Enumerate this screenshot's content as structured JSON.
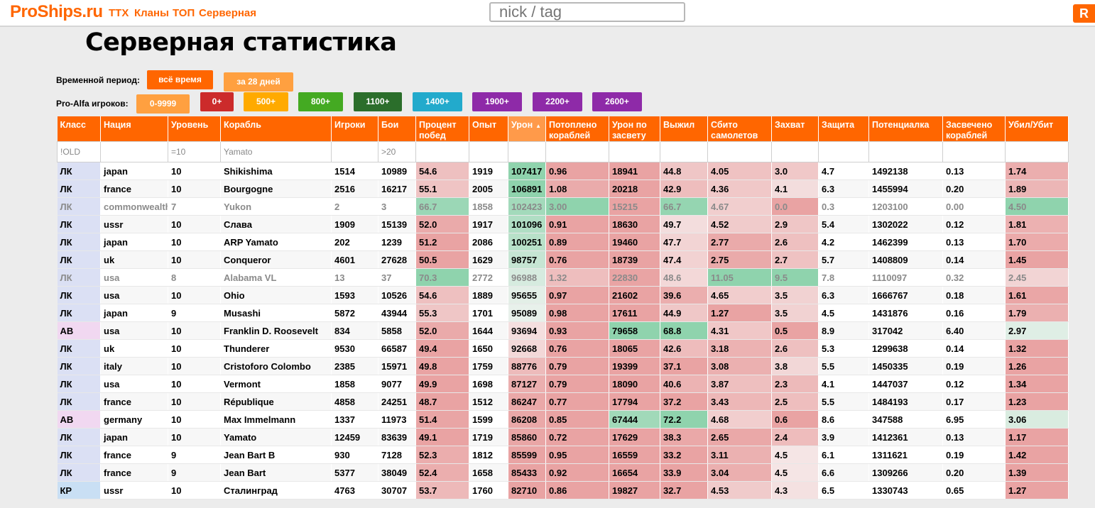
{
  "header": {
    "logo": "ProShips.ru",
    "nav": [
      "ТТХ",
      "Кланы",
      "ТОП",
      "Серверная"
    ],
    "search_placeholder": "nick / tag",
    "corner_button": "R"
  },
  "page_title": "Серверная статистика",
  "filters": {
    "period_label": "Временной период:",
    "period_buttons": [
      "всё время",
      "за 28 дней"
    ],
    "pro_label": "Pro-Alfa игроков:",
    "pro_buttons": [
      "0-9999",
      "0+",
      "500+",
      "800+",
      "1100+",
      "1400+",
      "1900+",
      "2200+",
      "2600+"
    ]
  },
  "colors": {
    "accent": "#ff6600",
    "good": "#8fd3ad",
    "bad": "#e9a3a3",
    "class_ЛК": "#dbe0f4",
    "class_АВ": "#f1d8f1",
    "class_КР": "#c9dff4"
  },
  "table": {
    "columns": [
      "Класс",
      "Нация",
      "Уровень",
      "Корабль",
      "Игроки",
      "Бои",
      "Процент побед",
      "Опыт",
      "Урон",
      "Потоплено кораблей",
      "Урон по засвету",
      "Выжил",
      "Сбито самолетов",
      "Захват",
      "Защита",
      "Потенциалка",
      "Засвечено кораблей",
      "Убил/Убит"
    ],
    "sorted_column": "Урон",
    "filters": [
      "!OLD",
      "",
      "=10",
      "Yamato",
      "",
      ">20",
      "",
      "",
      "",
      "",
      "",
      "",
      "",
      "",
      "",
      "",
      "",
      ""
    ],
    "rows": [
      {
        "dim": false,
        "cells": [
          "ЛК",
          "japan",
          "10",
          "Shikishima",
          "1514",
          "10989",
          "54.6",
          "1919",
          "107417",
          "0.96",
          "18941",
          "44.8",
          "4.05",
          "3.0",
          "4.7",
          "1492138",
          "0.13",
          "1.74"
        ]
      },
      {
        "dim": false,
        "cells": [
          "ЛК",
          "france",
          "10",
          "Bourgogne",
          "2516",
          "16217",
          "55.1",
          "2005",
          "106891",
          "1.08",
          "20218",
          "42.9",
          "4.36",
          "4.1",
          "6.3",
          "1455994",
          "0.20",
          "1.89"
        ]
      },
      {
        "dim": true,
        "cells": [
          "ЛК",
          "commonwealth",
          "7",
          "Yukon",
          "2",
          "3",
          "66.7",
          "1858",
          "102423",
          "3.00",
          "15215",
          "66.7",
          "4.67",
          "0.0",
          "0.3",
          "1203100",
          "0.00",
          "4.50"
        ]
      },
      {
        "dim": false,
        "cells": [
          "ЛК",
          "ussr",
          "10",
          "Слава",
          "1909",
          "15139",
          "52.0",
          "1917",
          "101096",
          "0.91",
          "18630",
          "49.7",
          "4.52",
          "2.9",
          "5.4",
          "1302022",
          "0.12",
          "1.81"
        ]
      },
      {
        "dim": false,
        "cells": [
          "ЛК",
          "japan",
          "10",
          "ARP Yamato",
          "202",
          "1239",
          "51.2",
          "2086",
          "100251",
          "0.89",
          "19460",
          "47.7",
          "2.77",
          "2.6",
          "4.2",
          "1462399",
          "0.13",
          "1.70"
        ]
      },
      {
        "dim": false,
        "cells": [
          "ЛК",
          "uk",
          "10",
          "Conqueror",
          "4601",
          "27628",
          "50.5",
          "1629",
          "98757",
          "0.76",
          "18739",
          "47.4",
          "2.75",
          "2.7",
          "5.7",
          "1408809",
          "0.14",
          "1.45"
        ]
      },
      {
        "dim": true,
        "cells": [
          "ЛК",
          "usa",
          "8",
          "Alabama VL",
          "13",
          "37",
          "70.3",
          "2772",
          "96988",
          "1.32",
          "22830",
          "48.6",
          "11.05",
          "9.5",
          "7.8",
          "1110097",
          "0.32",
          "2.45"
        ]
      },
      {
        "dim": false,
        "cells": [
          "ЛК",
          "usa",
          "10",
          "Ohio",
          "1593",
          "10526",
          "54.6",
          "1889",
          "95655",
          "0.97",
          "21602",
          "39.6",
          "4.65",
          "3.5",
          "6.3",
          "1666767",
          "0.18",
          "1.61"
        ]
      },
      {
        "dim": false,
        "cells": [
          "ЛК",
          "japan",
          "9",
          "Musashi",
          "5872",
          "43944",
          "55.3",
          "1701",
          "95089",
          "0.98",
          "17611",
          "44.9",
          "1.27",
          "3.5",
          "4.5",
          "1431876",
          "0.16",
          "1.79"
        ]
      },
      {
        "dim": false,
        "cells": [
          "АВ",
          "usa",
          "10",
          "Franklin D. Roosevelt",
          "834",
          "5858",
          "52.0",
          "1644",
          "93694",
          "0.93",
          "79658",
          "68.8",
          "4.31",
          "0.5",
          "8.9",
          "317042",
          "6.40",
          "2.97"
        ]
      },
      {
        "dim": false,
        "cells": [
          "ЛК",
          "uk",
          "10",
          "Thunderer",
          "9530",
          "66587",
          "49.4",
          "1650",
          "92668",
          "0.76",
          "18065",
          "42.6",
          "3.18",
          "2.6",
          "5.3",
          "1299638",
          "0.14",
          "1.32"
        ]
      },
      {
        "dim": false,
        "cells": [
          "ЛК",
          "italy",
          "10",
          "Cristoforo Colombo",
          "2385",
          "15971",
          "49.8",
          "1759",
          "88776",
          "0.79",
          "19399",
          "37.1",
          "3.08",
          "3.8",
          "5.5",
          "1450335",
          "0.19",
          "1.26"
        ]
      },
      {
        "dim": false,
        "cells": [
          "ЛК",
          "usa",
          "10",
          "Vermont",
          "1858",
          "9077",
          "49.9",
          "1698",
          "87127",
          "0.79",
          "18090",
          "40.6",
          "3.87",
          "2.3",
          "4.1",
          "1447037",
          "0.12",
          "1.34"
        ]
      },
      {
        "dim": false,
        "cells": [
          "ЛК",
          "france",
          "10",
          "République",
          "4858",
          "24251",
          "48.7",
          "1512",
          "86247",
          "0.77",
          "17794",
          "37.2",
          "3.43",
          "2.5",
          "5.5",
          "1484193",
          "0.17",
          "1.23"
        ]
      },
      {
        "dim": false,
        "cells": [
          "АВ",
          "germany",
          "10",
          "Max Immelmann",
          "1337",
          "11973",
          "51.4",
          "1599",
          "86208",
          "0.85",
          "67444",
          "72.2",
          "4.68",
          "0.6",
          "8.6",
          "347588",
          "6.95",
          "3.06"
        ]
      },
      {
        "dim": false,
        "cells": [
          "ЛК",
          "japan",
          "10",
          "Yamato",
          "12459",
          "83639",
          "49.1",
          "1719",
          "85860",
          "0.72",
          "17629",
          "38.3",
          "2.65",
          "2.4",
          "3.9",
          "1412361",
          "0.13",
          "1.17"
        ]
      },
      {
        "dim": false,
        "cells": [
          "ЛК",
          "france",
          "9",
          "Jean Bart B",
          "930",
          "7128",
          "52.3",
          "1812",
          "85599",
          "0.95",
          "16559",
          "33.2",
          "3.11",
          "4.5",
          "6.1",
          "1311621",
          "0.19",
          "1.42"
        ]
      },
      {
        "dim": false,
        "cells": [
          "ЛК",
          "france",
          "9",
          "Jean Bart",
          "5377",
          "38049",
          "52.4",
          "1658",
          "85433",
          "0.92",
          "16654",
          "33.9",
          "3.04",
          "4.5",
          "6.6",
          "1309266",
          "0.20",
          "1.39"
        ]
      },
      {
        "dim": false,
        "cells": [
          "КР",
          "ussr",
          "10",
          "Сталинград",
          "4763",
          "30707",
          "53.7",
          "1760",
          "82710",
          "0.86",
          "19827",
          "32.7",
          "4.53",
          "4.3",
          "6.5",
          "1330743",
          "0.65",
          "1.27"
        ]
      }
    ]
  }
}
